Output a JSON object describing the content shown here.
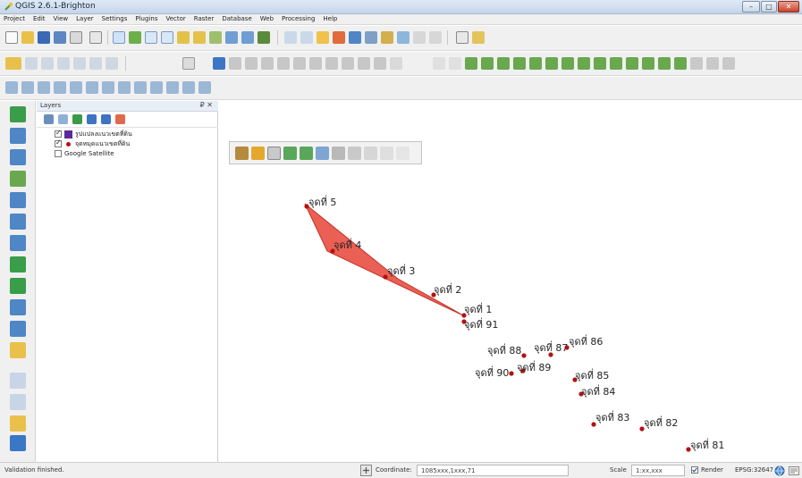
{
  "window": {
    "title": "QGIS 2.6.1-Brighton",
    "minimize_label": "–",
    "maximize_label": "□",
    "close_label": "✕"
  },
  "menu": [
    "Project",
    "Edit",
    "View",
    "Layer",
    "Settings",
    "Plugins",
    "Vector",
    "Raster",
    "Database",
    "Web",
    "Processing",
    "Help"
  ],
  "layers_panel": {
    "title": "Layers",
    "controls": "₽ ✕",
    "items": [
      {
        "label": "รูปแปลงแนวเขตที่ดิน",
        "checked": true,
        "symbol": "polygon"
      },
      {
        "label": "จุดหมุดแนวเขตที่ดิน",
        "checked": true,
        "symbol": "point"
      },
      {
        "label": "Google Satellite",
        "checked": false,
        "symbol": "none"
      }
    ]
  },
  "map": {
    "polygon_color": "#e84a3c",
    "point_color": "#b31212",
    "points": [
      {
        "label": "จุดที่ 5"
      },
      {
        "label": "จุดที่ 4"
      },
      {
        "label": "จุดที่ 3"
      },
      {
        "label": "จุดที่ 2"
      },
      {
        "label": "จุดที่ 1"
      },
      {
        "label": "จุดที่ 91"
      },
      {
        "label": "จุดที่ 88"
      },
      {
        "label": "จุดที่ 87"
      },
      {
        "label": "จุดที่ 86"
      },
      {
        "label": "จุดที่ 90"
      },
      {
        "label": "จุดที่ 89"
      },
      {
        "label": "จุดที่ 85"
      },
      {
        "label": "จุดที่ 84"
      },
      {
        "label": "จุดที่ 83"
      },
      {
        "label": "จุดที่ 82"
      },
      {
        "label": "จุดที่ 81"
      }
    ]
  },
  "statusbar": {
    "message": "Validation finished.",
    "coordinate_label": "Coordinate:",
    "coordinate_value": "1085xxx,1xxx,71",
    "scale_label": "Scale",
    "scale_value": "1:xx,xxx",
    "render_label": "Render",
    "crs": "EPSG:32647"
  }
}
